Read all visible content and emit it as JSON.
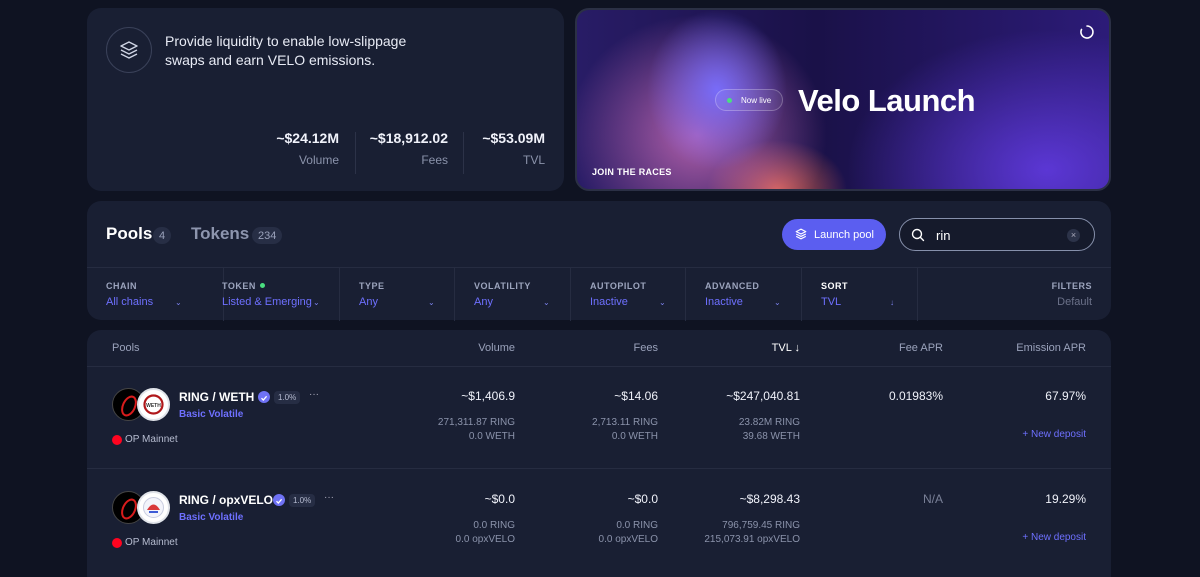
{
  "info": {
    "text": "Provide liquidity to enable low-slippage swaps and earn VELO emissions.",
    "stats": [
      {
        "value": "~$24.12M",
        "label": "Volume"
      },
      {
        "value": "~$18,912.02",
        "label": "Fees"
      },
      {
        "value": "~$53.09M",
        "label": "TVL"
      }
    ]
  },
  "banner": {
    "pill": "Now live",
    "title": "Velo Launch",
    "cta": "JOIN THE RACES"
  },
  "tabs": [
    {
      "label": "Pools",
      "count": "4"
    },
    {
      "label": "Tokens",
      "count": "234"
    }
  ],
  "launch_button": "Launch pool",
  "search": {
    "value": "rin"
  },
  "filters": [
    {
      "label": "CHAIN",
      "value": "All chains"
    },
    {
      "label": "TOKEN",
      "value": "Listed & Emerging"
    },
    {
      "label": "TYPE",
      "value": "Any"
    },
    {
      "label": "VOLATILITY",
      "value": "Any"
    },
    {
      "label": "AUTOPILOT",
      "value": "Inactive"
    },
    {
      "label": "ADVANCED",
      "value": "Inactive"
    },
    {
      "label": "SORT",
      "value": "TVL"
    },
    {
      "label": "FILTERS",
      "value": "Default"
    }
  ],
  "table": {
    "headers": [
      "Pools",
      "Volume",
      "Fees",
      "TVL",
      "Fee APR",
      "Emission APR"
    ],
    "sort_arrow": "↓",
    "rows": [
      {
        "pair": "RING / WETH",
        "fee": "1.0%",
        "type": "Basic Volatile",
        "network": "OP Mainnet",
        "logo2": "WETH",
        "volume": "~$1,406.9",
        "volume_sub": [
          "271,311.87 RING",
          "0.0 WETH"
        ],
        "fees": "~$14.06",
        "fees_sub": [
          "2,713.11 RING",
          "0.0 WETH"
        ],
        "tvl": "~$247,040.81",
        "tvl_sub": [
          "23.82M RING",
          "39.68 WETH"
        ],
        "fee_apr": "0.01983%",
        "emission_apr": "67.97%",
        "action": "New deposit"
      },
      {
        "pair": "RING / opxVELO",
        "fee": "1.0%",
        "type": "Basic Volatile",
        "network": "OP Mainnet",
        "logo2": "",
        "volume": "~$0.0",
        "volume_sub": [
          "0.0 RING",
          "0.0 opxVELO"
        ],
        "fees": "~$0.0",
        "fees_sub": [
          "0.0 RING",
          "0.0 opxVELO"
        ],
        "tvl": "~$8,298.43",
        "tvl_sub": [
          "796,759.45 RING",
          "215,073.91 opxVELO"
        ],
        "fee_apr": "N/A",
        "emission_apr": "19.29%",
        "action": "New deposit"
      }
    ]
  },
  "colors": {
    "accent": "#5b5ef0",
    "link": "#6e70ff",
    "live": "#4ade80",
    "op": "#ff0420"
  }
}
